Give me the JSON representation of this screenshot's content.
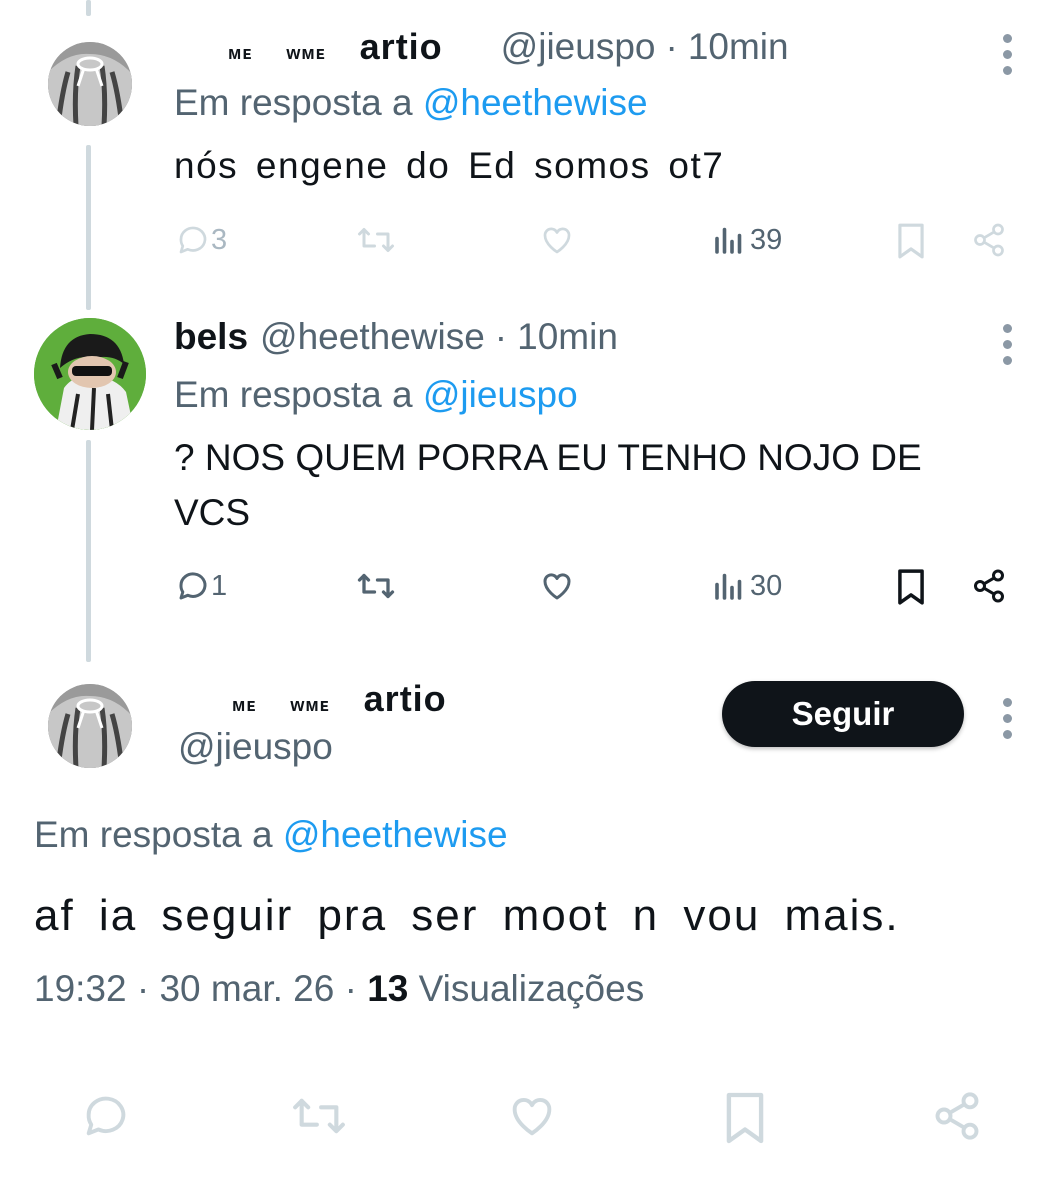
{
  "tweet1": {
    "display_name_parts": [
      "ᴍᴇ",
      "ᴡᴍᴇ",
      "artio"
    ],
    "handle": "@jieuspo",
    "separator": "·",
    "time": "10min",
    "reply_prefix": "Em resposta a",
    "reply_to": "@heethewise",
    "text": "nós engene do Ed somos ot7",
    "replies": "3",
    "views": "39"
  },
  "tweet2": {
    "display_name": "bels",
    "handle": "@heethewise",
    "separator": "·",
    "time": "10min",
    "reply_prefix": "Em resposta a",
    "reply_to": "@jieuspo",
    "text": "? NOS QUEM PORRA EU TENHO NOJO DE VCS",
    "replies": "1",
    "views": "30"
  },
  "main_tweet": {
    "display_name_parts": [
      "ᴍᴇ",
      "ᴡᴍᴇ",
      "artio"
    ],
    "handle": "@jieuspo",
    "follow_label": "Seguir",
    "reply_prefix": "Em resposta a",
    "reply_to": "@heethewise",
    "text": "af ia seguir pra ser moot n vou mais.",
    "time": "19:32",
    "date": "30 mar. 26",
    "views_count": "13",
    "views_label": "Visualizações"
  },
  "icons": [
    "reply-icon",
    "retweet-icon",
    "like-icon",
    "views-icon",
    "bookmark-icon",
    "share-icon",
    "more-icon"
  ],
  "colors": {
    "link": "#1d9bf0",
    "secondary": "#536471",
    "text": "#0f1419",
    "thread_line": "#cfd9de"
  }
}
